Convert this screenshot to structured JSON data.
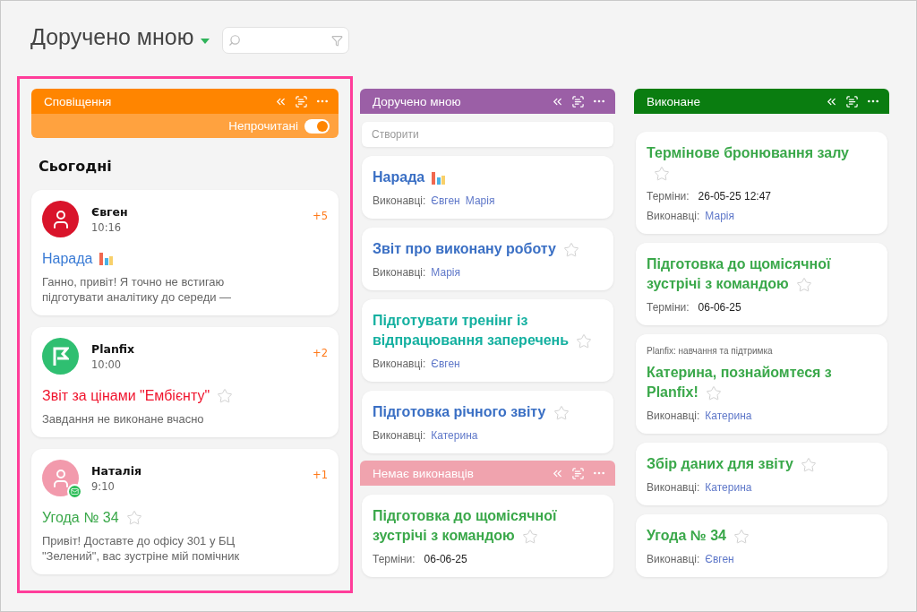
{
  "page": {
    "title": "Доручено мною"
  },
  "notifications": {
    "header": {
      "title": "Сповіщення"
    },
    "filter": {
      "label": "Непрочитані",
      "on": true
    },
    "section_title": "Сьогодні",
    "items": [
      {
        "avatar": {
          "kind": "photo",
          "color": "#d9142b",
          "mail_badge": false
        },
        "name": "Євген",
        "time": "10:16",
        "count": "+5",
        "task": {
          "title": "Нарада",
          "color": "#3a7bd5",
          "kind": "chart"
        },
        "text": "Ганно, привіт! Я точно не встигаю підготувати аналітику до середи —"
      },
      {
        "avatar": {
          "kind": "logo",
          "color": "#2fbf71",
          "mail_badge": false
        },
        "name": "Planfix",
        "time": "10:00",
        "count": "+2",
        "task": {
          "title": "Звіт за цінами \"Ембієнту\"",
          "color": "#f0142d",
          "kind": "star"
        },
        "text": "Завдання не виконане вчасно"
      },
      {
        "avatar": {
          "kind": "photo",
          "color": "#f29aac",
          "mail_badge": true
        },
        "name": "Наталія",
        "time": "9:10",
        "count": "+1",
        "task": {
          "title": "Угода № 34",
          "color": "#3aa84a",
          "kind": "star"
        },
        "text": "Привіт! Доставте до офісу 301 у БЦ \"Зелений\", вас зустріне мій помічник"
      }
    ]
  },
  "columns": [
    {
      "sections": [
        {
          "header": {
            "title": "Доручено мною",
            "color": "#9b5fa6"
          },
          "create": {
            "placeholder": "Створити"
          },
          "cards": [
            {
              "title": "Нарада",
              "color": "#3a6fc4",
              "kind": "chart",
              "fields": [
                {
                  "kind": "people",
                  "label": "Виконавці:",
                  "values": [
                    "Євген",
                    "Марія"
                  ]
                }
              ]
            },
            {
              "title": "Звіт про виконану роботу",
              "color": "#3a6fc4",
              "kind": "star",
              "fields": [
                {
                  "kind": "people",
                  "label": "Виконавці:",
                  "values": [
                    "Марія"
                  ]
                }
              ]
            },
            {
              "title": "Підготувати тренінг із відпрацювання заперечень",
              "color": "#14b0a0",
              "kind": "star",
              "fields": [
                {
                  "kind": "people",
                  "label": "Виконавці:",
                  "values": [
                    "Євген"
                  ]
                }
              ]
            },
            {
              "title": "Підготовка річного звіту",
              "color": "#3a6fc4",
              "kind": "star",
              "fields": [
                {
                  "kind": "people",
                  "label": "Виконавці:",
                  "values": [
                    "Катерина"
                  ]
                }
              ]
            }
          ]
        },
        {
          "header": {
            "title": "Немає виконавців",
            "color": "#f0a3ae"
          },
          "cards": [
            {
              "title": "Підготовка до щомісячної зустрічі з командою",
              "color": "#3aa84a",
              "kind": "star",
              "fields": [
                {
                  "kind": "date",
                  "label": "Терміни:",
                  "values": [
                    "06-06-25"
                  ]
                }
              ]
            }
          ]
        }
      ]
    },
    {
      "sections": [
        {
          "header": {
            "title": "Виконане",
            "color": "#0a7d10"
          },
          "cards": [
            {
              "title": "Термінове бронювання залу",
              "color": "#3aa84a",
              "kind": "star",
              "fields": [
                {
                  "kind": "date",
                  "label": "Терміни:",
                  "values": [
                    "26-05-25 12:47"
                  ]
                },
                {
                  "kind": "people",
                  "label": "Виконавці:",
                  "values": [
                    "Марія"
                  ]
                }
              ]
            },
            {
              "title": "Підготовка до щомісячної зустрічі з командою",
              "color": "#3aa84a",
              "kind": "star",
              "fields": [
                {
                  "kind": "date",
                  "label": "Терміни:",
                  "values": [
                    "06-06-25"
                  ]
                }
              ]
            },
            {
              "project": "Planfix: навчання та підтримка",
              "title": "Катерина, познайомтеся з Planfix!",
              "color": "#3aa84a",
              "kind": "star",
              "fields": [
                {
                  "kind": "people",
                  "label": "Виконавці:",
                  "values": [
                    "Катерина"
                  ]
                }
              ]
            },
            {
              "title": "Збір даних для звіту",
              "color": "#3aa84a",
              "kind": "star",
              "fields": [
                {
                  "kind": "people",
                  "label": "Виконавці:",
                  "values": [
                    "Катерина"
                  ]
                }
              ]
            },
            {
              "title": "Угода № 34",
              "color": "#3aa84a",
              "kind": "star",
              "fields": [
                {
                  "kind": "people",
                  "label": "Виконавці:",
                  "values": [
                    "Євген"
                  ]
                }
              ]
            }
          ]
        }
      ]
    }
  ]
}
